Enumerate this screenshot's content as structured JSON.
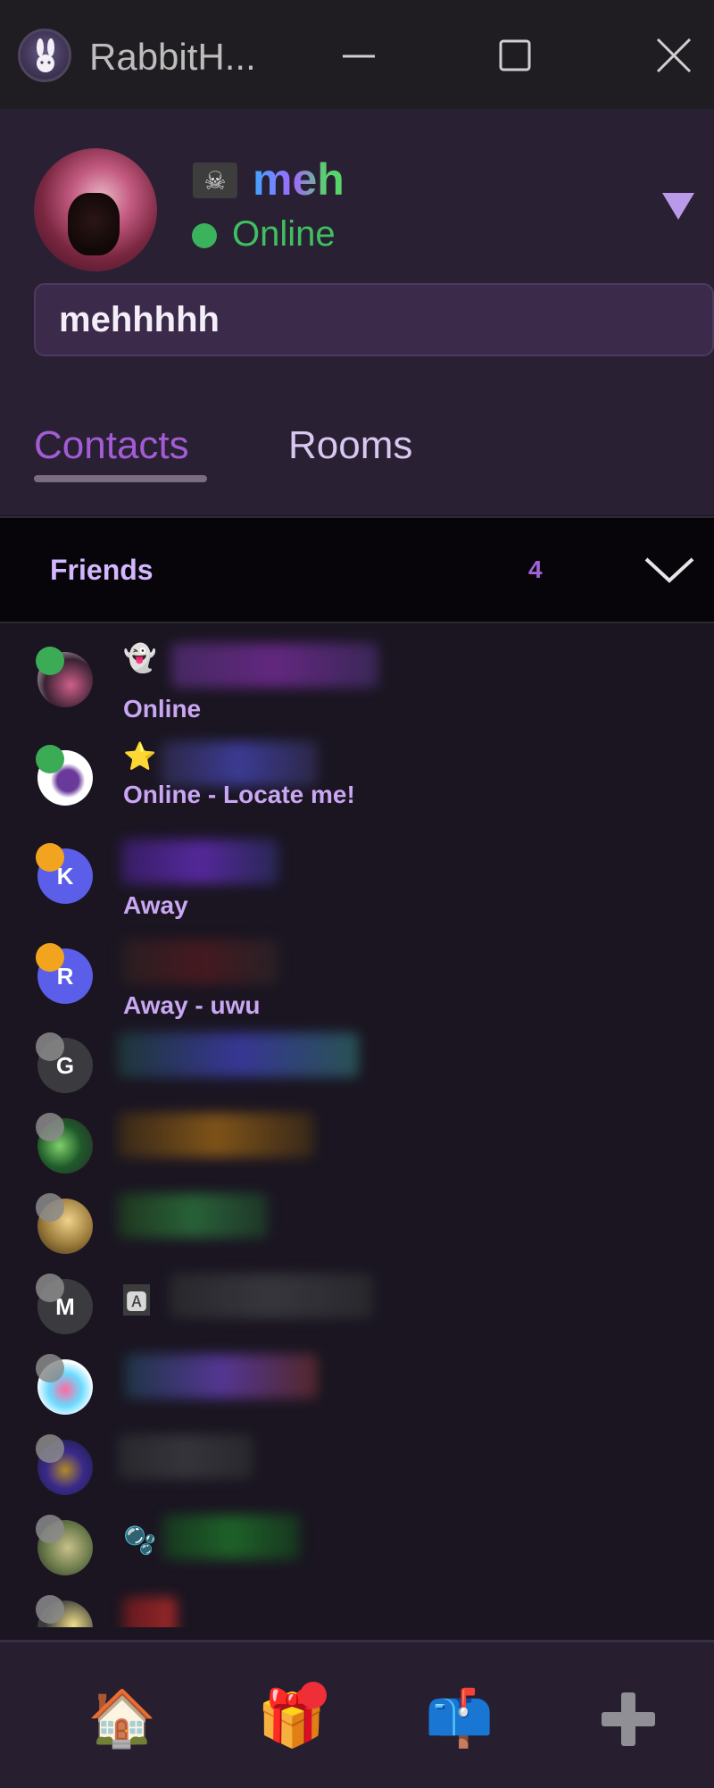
{
  "window": {
    "title": "RabbitH...",
    "controls": [
      "minimize",
      "maximize",
      "close"
    ]
  },
  "profile": {
    "icon": "pirate-flag-icon",
    "username": "meh",
    "status": "Online",
    "status_message": "mehhhhh",
    "dropdown_icon": "triangle-down-icon"
  },
  "tabs": [
    {
      "label": "Contacts",
      "active": true
    },
    {
      "label": "Rooms",
      "active": false
    }
  ],
  "group": {
    "title": "Friends",
    "count": "4",
    "chevron_icon": "chevron-down-icon"
  },
  "contacts": [
    {
      "emoji": "👻",
      "status": "Online",
      "presence": "online"
    },
    {
      "emoji": "⭐",
      "status": "Online - Locate me!",
      "presence": "online"
    },
    {
      "emoji": "",
      "status": "Away",
      "presence": "away",
      "avatar_letter": "K"
    },
    {
      "emoji": "",
      "status": "Away - uwu",
      "presence": "away",
      "avatar_letter": "R"
    },
    {
      "emoji": "",
      "status": "",
      "presence": "offline",
      "avatar_letter": "G"
    },
    {
      "emoji": "",
      "status": "",
      "presence": "offline"
    },
    {
      "emoji": "",
      "status": "",
      "presence": "offline"
    },
    {
      "emoji": "🅰",
      "status": "",
      "presence": "offline",
      "avatar_letter": "M"
    },
    {
      "emoji": "",
      "status": "",
      "presence": "offline"
    },
    {
      "emoji": "",
      "status": "",
      "presence": "offline"
    },
    {
      "emoji": "🫧",
      "status": "",
      "presence": "offline"
    },
    {
      "emoji": "",
      "status": "",
      "presence": "offline"
    }
  ],
  "bottom_nav": {
    "home": "🏠",
    "gift": "🎁",
    "mail": "📫",
    "add": "➕"
  },
  "colors": {
    "accent": "#a45cd6",
    "online": "#3bab55",
    "away": "#f3a41e",
    "offline": "#8b8b8b",
    "status_text": "#c9a7f2"
  }
}
